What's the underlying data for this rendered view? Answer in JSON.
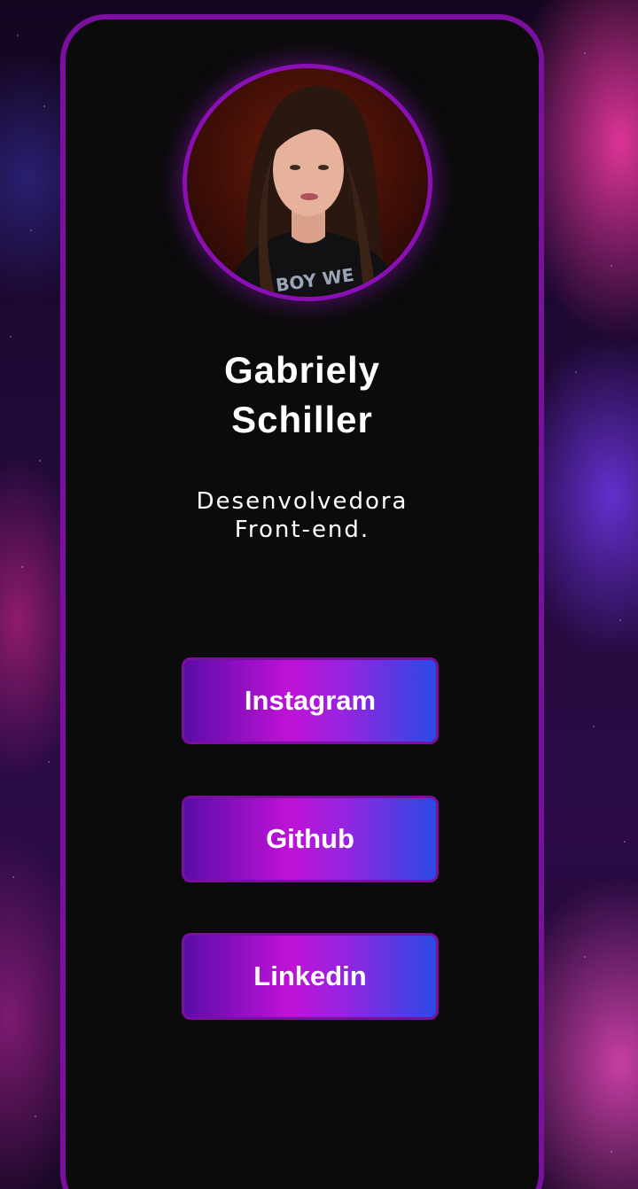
{
  "profile": {
    "name_line1": "Gabriely",
    "name_line2": "Schiller",
    "role_line1": "Desenvolvedora",
    "role_line2": "Front-end."
  },
  "links": [
    {
      "label": "Instagram"
    },
    {
      "label": "Github"
    },
    {
      "label": "Linkedin"
    }
  ],
  "colors": {
    "card_background": "#0b0b0b",
    "card_border": "#7a0fa0",
    "button_gradient_start": "#5a0ca8",
    "button_gradient_mid": "#c012d6",
    "button_gradient_end": "#2a4ae6",
    "text": "#ffffff"
  }
}
